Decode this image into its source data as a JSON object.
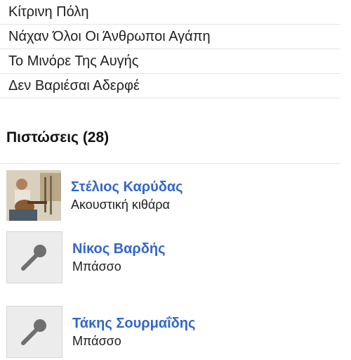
{
  "songs": [
    "Κίτρινη Πόλη",
    "Νάχαν Όλοι Οι Άνθρωποι Αγάπη",
    "Το Μινόρε Της Αυγής",
    "Δεν Βαριέσαι Αδερφέ"
  ],
  "credits": {
    "title": "Πιστώσεις (28)",
    "items": [
      {
        "name": "Στέλιος Καρύδας",
        "role": "Ακουστική κιθάρα",
        "thumb": "photo"
      },
      {
        "name": "Νίκος Βαρδής",
        "role": "Μπάσσο",
        "thumb": "microphone-icon"
      },
      {
        "name": "Τάκης Σουρμαΐδης",
        "role": "Μπάσσο",
        "thumb": "microphone-icon"
      }
    ]
  },
  "colors": {
    "link": "#3366cc",
    "divider": "#e4e4e4",
    "placeholder": "#ececec",
    "icon": "#6f6f6f"
  }
}
